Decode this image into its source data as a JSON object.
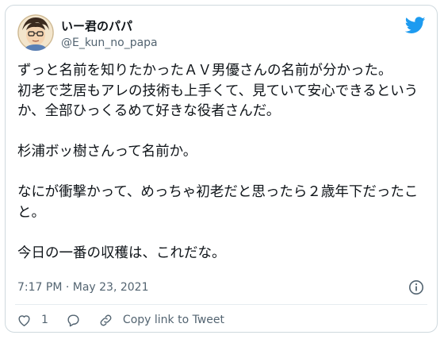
{
  "user": {
    "display_name": "いー君のパパ",
    "handle": "@E_kun_no_papa"
  },
  "tweet": {
    "paragraphs": [
      "ずっと名前を知りたかったＡＶ男優さんの名前が分かった。\n初老で芝居もアレの技術も上手くて、見ていて安心できるというか、全部ひっくるめて好きな役者さんだ。",
      "杉浦ボッ樹さんって名前か。",
      "なにが衝撃かって、めっちゃ初老だと思ったら２歳年下だったこと。",
      "今日の一番の収穫は、これだな。"
    ],
    "timestamp": "7:17 PM · May 23, 2021"
  },
  "actions": {
    "like_count": "1",
    "copy_link_label": "Copy link to Tweet"
  },
  "icons": {
    "brand": "twitter-bird-icon",
    "info": "info-icon",
    "like": "heart-icon",
    "reply": "reply-bubble-icon",
    "copy": "link-icon"
  },
  "colors": {
    "brand": "#1d9bf0",
    "text": "#0f1419",
    "secondary": "#536471",
    "border": "#cfd9de"
  }
}
